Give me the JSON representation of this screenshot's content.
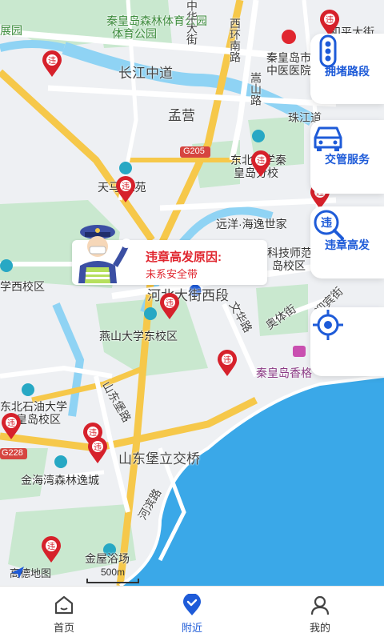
{
  "map": {
    "labels": {
      "park": "秦皇岛森林体育公园",
      "park2": "体育公园",
      "zhan": "展园",
      "changjiang": "长江中道",
      "xihuan": "西环南路",
      "zhonghua": "中华大街",
      "tcm1": "秦皇岛市",
      "tcm2": "中医医院",
      "songshan": "嵩山路",
      "zhujiang": "珠江道",
      "mengying": "孟营",
      "g205": "G205",
      "hp": "和平大街",
      "dongbei1": "东北大学秦",
      "dongbei2": "皇岛分校",
      "tianma": "天马·江苑",
      "yuanyang": "远洋·海逸世家",
      "keji1": "科技师范",
      "keji2": "岛校区",
      "xiqu": "学西校区",
      "hebei": "河北大街西段",
      "yanshan": "燕山大学东校区",
      "wenhua": "文华路",
      "aoti": "奥体街",
      "yingbin": "迎宾街",
      "xiangge": "秦皇岛香格",
      "shandong": "山东堡路",
      "dongshi1": "东北石油大学",
      "dongshi2": "秦皇岛校区",
      "g228": "G228",
      "sdbridge": "山东堡立交桥",
      "jinhai": "金海湾森林逸城",
      "hebin": "河滨路",
      "jinwu": "金屋浴场"
    },
    "logo": "高德地图",
    "scale": "500m"
  },
  "tooltip": {
    "title": "违章高发原因:",
    "reason": "未系安全带"
  },
  "side_buttons": {
    "congestion": "拥堵路段",
    "traffic_service": "交管服务",
    "violation_hotspot": "违章高发"
  },
  "tabs": {
    "home": "首页",
    "nearby": "附近",
    "mine": "我的"
  },
  "colors": {
    "accent": "#1e5bd8",
    "pin": "#d6212b",
    "road": "#f6c84a",
    "water": "#3aa8e8",
    "green": "#c9e8cf"
  }
}
